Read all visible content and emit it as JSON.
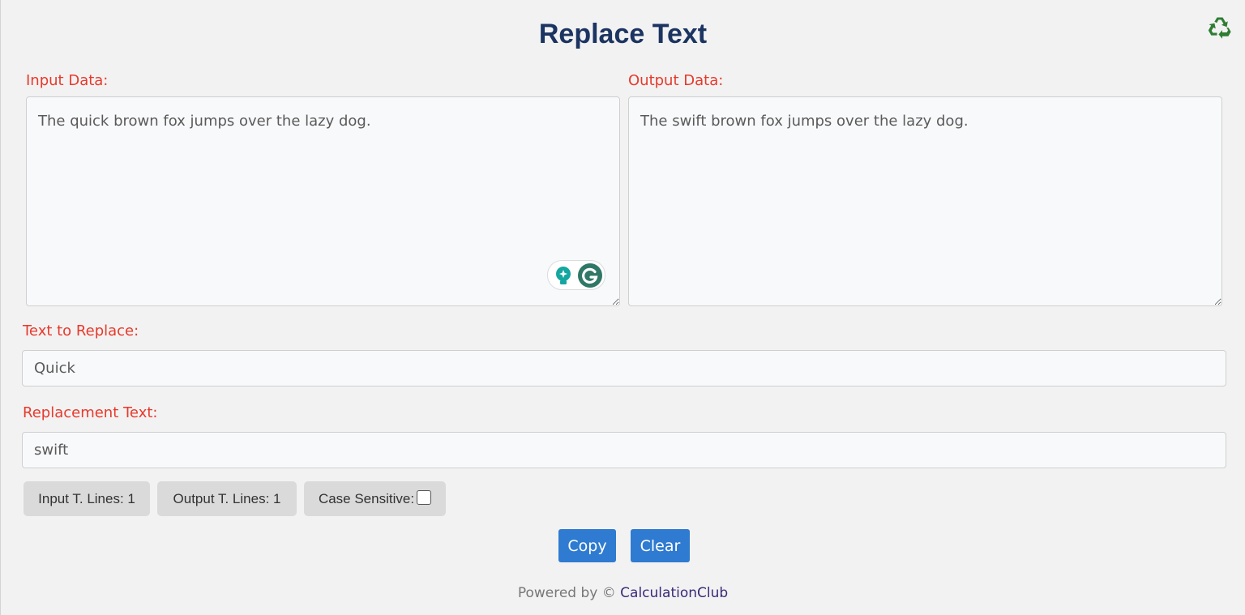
{
  "header": {
    "title": "Replace Text",
    "recycle_icon_color": "#2e7d32"
  },
  "input_panel": {
    "label": "Input Data:",
    "value": "The quick brown fox jumps over the lazy dog."
  },
  "output_panel": {
    "label": "Output Data:",
    "value": "The swift brown fox jumps over the lazy dog."
  },
  "find_field": {
    "label": "Text to Replace:",
    "placeholder": "Quick"
  },
  "replace_field": {
    "label": "Replacement Text:",
    "placeholder": "swift"
  },
  "stats": {
    "input_lines": "Input T. Lines: 1",
    "output_lines": "Output T. Lines: 1",
    "case_sensitive": "Case Sensitive:"
  },
  "actions": {
    "copy_label": "Copy",
    "clear_label": "Clear"
  },
  "footer": {
    "powered_by": "Powered by © ",
    "brand": "CalculationClub"
  },
  "colors": {
    "title": "#1c3461",
    "label": "#e8392b",
    "button": "#2f7bd1",
    "brand_link": "#3a2a78",
    "grammarly": "#15c39a"
  }
}
